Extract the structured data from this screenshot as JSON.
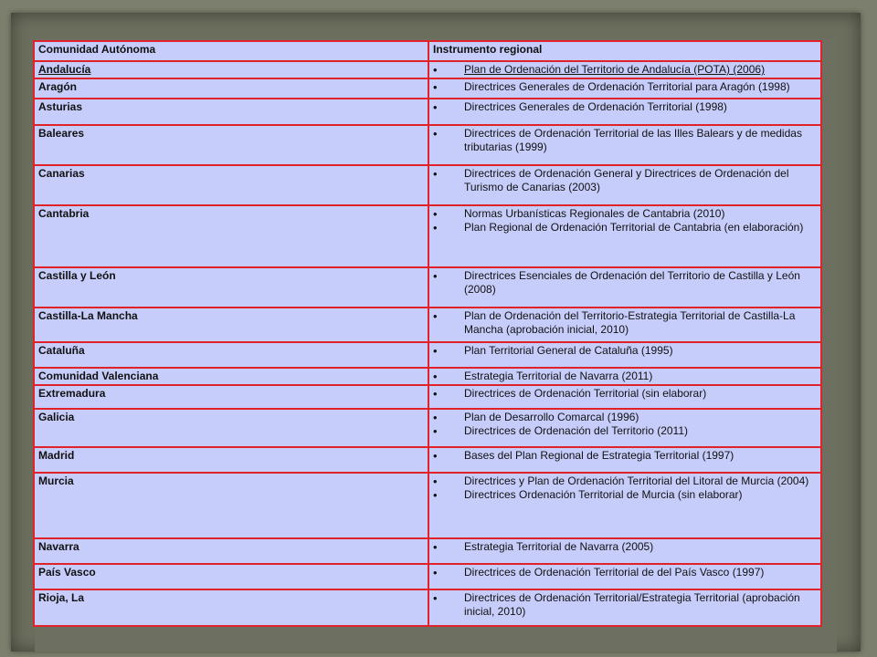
{
  "table": {
    "header": {
      "community": "Comunidad Autónoma",
      "instrument": "Instrumento regional"
    },
    "rows": [
      {
        "community": "Andalucía",
        "instruments": [
          "Plan de Ordenación del Territorio de Andalucía (POTA) (2006)"
        ]
      },
      {
        "community": "Aragón",
        "instruments": [
          "Directrices Generales de Ordenación Territorial para Aragón (1998)"
        ]
      },
      {
        "community": "Asturias",
        "instruments": [
          "Directrices Generales de Ordenación Territorial (1998)"
        ]
      },
      {
        "community": "Baleares",
        "instruments": [
          "Directrices de Ordenación Territorial de las Illes Balears y de medidas tributarias (1999)"
        ]
      },
      {
        "community": "Canarias",
        "instruments": [
          "Directrices de Ordenación General y Directrices de Ordenación del Turismo de Canarias (2003)"
        ]
      },
      {
        "community": "Cantabria",
        "instruments": [
          "Normas Urbanísticas Regionales de Cantabria (2010)",
          "Plan Regional de Ordenación Territorial de Cantabria (en elaboración)"
        ]
      },
      {
        "community": "Castilla y León",
        "instruments": [
          "Directrices Esenciales de Ordenación del Territorio de Castilla y León (2008)"
        ]
      },
      {
        "community": "Castilla-La Mancha",
        "instruments": [
          "Plan de Ordenación del Territorio-Estrategia Territorial de Castilla-La Mancha (aprobación inicial, 2010)"
        ]
      },
      {
        "community": "Cataluña",
        "instruments": [
          "Plan Territorial General de Cataluña (1995)"
        ]
      },
      {
        "community": "Comunidad Valenciana",
        "instruments": [
          "Estrategia Territorial de Navarra (2011)"
        ]
      },
      {
        "community": "Extremadura",
        "instruments": [
          "Directrices de Ordenación Territorial (sin elaborar)"
        ]
      },
      {
        "community": "Galicia",
        "instruments": [
          "Plan de Desarrollo Comarcal (1996)",
          "Directrices de Ordenación del Territorio (2011)"
        ]
      },
      {
        "community": "Madrid",
        "instruments": [
          "Bases del Plan Regional de Estrategia Territorial (1997)"
        ]
      },
      {
        "community": "Murcia",
        "instruments": [
          "Directrices y Plan de Ordenación Territorial del Litoral de Murcia (2004)",
          "Directrices Ordenación Territorial de Murcia (sin elaborar)"
        ]
      },
      {
        "community": "Navarra",
        "instruments": [
          "Estrategia Territorial de Navarra (2005)"
        ]
      },
      {
        "community": "País Vasco",
        "instruments": [
          "Directrices de Ordenación Territorial de del País Vasco (1997)"
        ]
      },
      {
        "community": "Rioja, La",
        "instruments": [
          "Directrices de Ordenación Territorial/Estrategia Territorial (aprobación inicial, 2010)"
        ]
      }
    ]
  },
  "colors": {
    "background": "#7d7f6e",
    "table_fill": "#c7cdfa",
    "border": "#e0232b"
  }
}
